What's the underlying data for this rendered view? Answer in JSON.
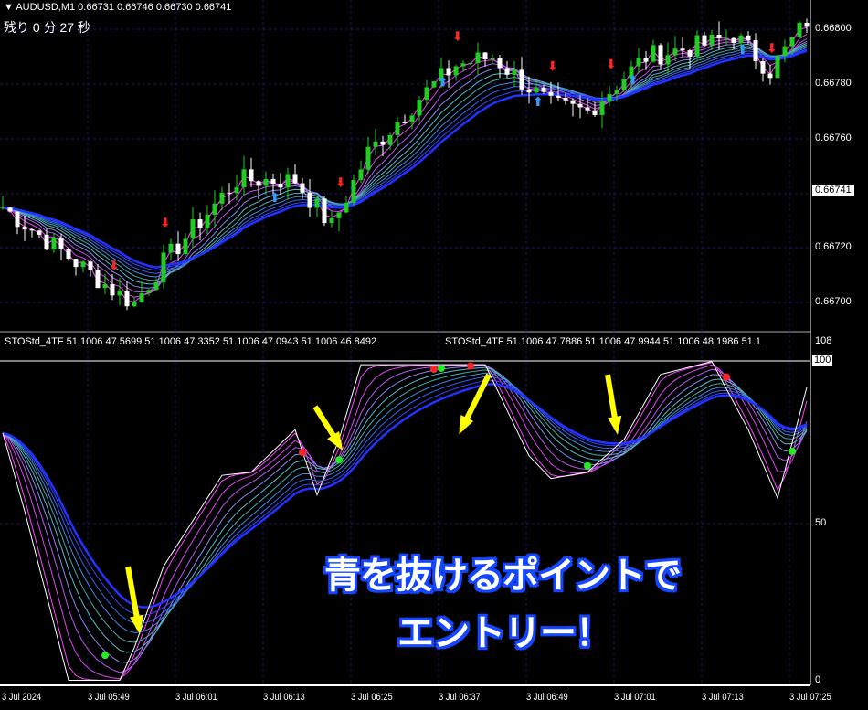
{
  "header": {
    "symbol_line": "AUDUSD,M1  0.66731 0.66746 0.66730 0.66741",
    "timer_label": "残り  0  分  27  秒"
  },
  "indicator": {
    "label1": "STOStd_4TF 51.1006 47.5699 51.1006 47.3352 51.1006 47.0943 51.1006 46.8492",
    "label2": "STOStd_4TF 51.1006 47.7886 51.1006 47.9944 51.1006 48.1986 51.1"
  },
  "price_axis": [
    "0.66800",
    "0.66780",
    "0.66760",
    "0.66720",
    "0.66700"
  ],
  "current_price": "0.66741",
  "ind_axis": {
    "top": "108",
    "hi": "100",
    "mid": "50",
    "low": "0"
  },
  "time_axis": [
    "3 Jul 2024",
    "3 Jul 05:49",
    "3 Jul 06:01",
    "3 Jul 06:13",
    "3 Jul 06:25",
    "3 Jul 06:37",
    "3 Jul 06:49",
    "3 Jul 07:01",
    "3 Jul 07:13",
    "3 Jul 07:25"
  ],
  "annotation": {
    "line1": "青を抜けるポイントで",
    "line2": "エントリー！"
  },
  "colors": {
    "bull": "#22cc22",
    "bear": "#ffffff",
    "grid": "#1a1a66",
    "up_arrow": "#3399ff",
    "down_arrow": "#ff2222",
    "arrow": "#ffff00"
  },
  "chart_data": {
    "type": "candlestick",
    "price_keypoints": [
      [
        0,
        0.66735
      ],
      [
        15,
        0.66705
      ],
      [
        18,
        0.667
      ],
      [
        22,
        0.66715
      ],
      [
        32,
        0.66745
      ],
      [
        40,
        0.66745
      ],
      [
        45,
        0.66728
      ],
      [
        50,
        0.66755
      ],
      [
        57,
        0.66775
      ],
      [
        62,
        0.66787
      ],
      [
        67,
        0.6679
      ],
      [
        75,
        0.66772
      ],
      [
        80,
        0.6677
      ],
      [
        88,
        0.6679
      ],
      [
        97,
        0.66795
      ],
      [
        100,
        0.66798
      ],
      [
        105,
        0.66785
      ],
      [
        110,
        0.66803
      ]
    ],
    "ylim": [
      0.6669,
      0.6681
    ],
    "stoch_keypoints": [
      [
        0,
        77
      ],
      [
        3,
        53
      ],
      [
        6,
        27
      ],
      [
        9,
        1
      ],
      [
        16,
        1
      ],
      [
        18,
        11
      ],
      [
        22,
        36
      ],
      [
        30,
        64
      ],
      [
        34,
        65
      ],
      [
        40,
        78
      ],
      [
        43,
        58
      ],
      [
        46,
        75
      ],
      [
        49,
        98
      ],
      [
        60,
        98
      ],
      [
        66,
        98
      ],
      [
        72,
        70
      ],
      [
        75,
        63
      ],
      [
        80,
        65
      ],
      [
        85,
        75
      ],
      [
        90,
        95
      ],
      [
        97,
        99
      ],
      [
        102,
        78
      ],
      [
        106,
        57
      ],
      [
        110,
        91
      ]
    ],
    "stoch_ylim": [
      0,
      108
    ]
  }
}
